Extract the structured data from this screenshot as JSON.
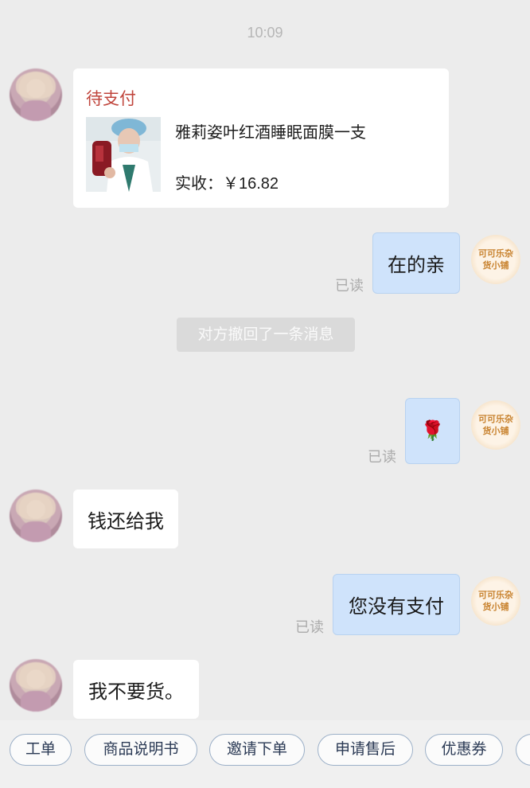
{
  "time": "10:09",
  "order": {
    "status": "待支付",
    "product_name": "雅莉姿叶红酒睡眠面膜一支",
    "price": "实收：￥16.82"
  },
  "messages": {
    "m1": "在的亲",
    "m1_read": "已读",
    "recall": "对方撤回了一条消息",
    "m2_emoji": "🌹",
    "m2_read": "已读",
    "m3": "钱还给我",
    "m4": "您没有支付",
    "m4_read": "已读",
    "m5": "我不要货。"
  },
  "shop_badge": {
    "line1": "可可乐杂",
    "line2": "货小铺"
  },
  "quick_actions": [
    "工单",
    "商品说明书",
    "邀请下单",
    "申请售后",
    "优惠券"
  ],
  "colors": {
    "accent_red": "#c0453c",
    "outgoing_bubble": "#cfe3fb",
    "shop_gold": "#c8822e"
  }
}
